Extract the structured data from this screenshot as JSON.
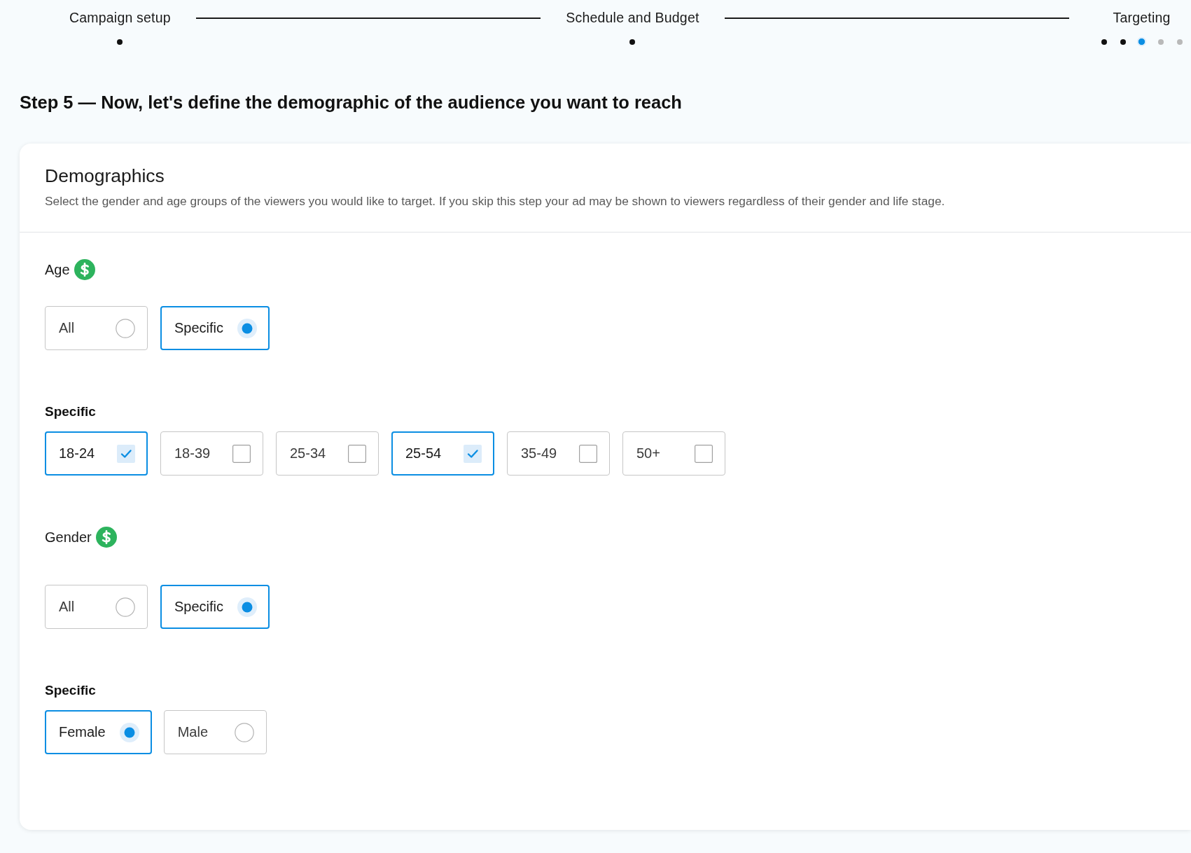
{
  "stepper": {
    "steps": [
      {
        "label": "Campaign setup",
        "dots": [
          {
            "completed": true,
            "selected": false
          }
        ]
      },
      {
        "label": "Schedule and Budget",
        "dots": [
          {
            "completed": true,
            "selected": false
          }
        ]
      },
      {
        "label": "Targeting",
        "dots": [
          {
            "completed": true,
            "selected": false
          },
          {
            "completed": true,
            "selected": false
          },
          {
            "completed": false,
            "selected": true
          },
          {
            "completed": false,
            "selected": false
          },
          {
            "completed": false,
            "selected": false
          }
        ]
      }
    ]
  },
  "heading": "Step 5 — Now, let's define the demographic of the audience you want to reach",
  "demographics": {
    "title": "Demographics",
    "description": "Select the gender and age groups of the viewers you would like to target. If you skip this step your ad may be shown to viewers regardless of their gender and life stage.",
    "groups": [
      {
        "label": "Age",
        "modes": [
          {
            "label": "All",
            "selected": false
          },
          {
            "label": "Specific",
            "selected": true
          }
        ],
        "specific": {
          "label": "Specific",
          "kind": "checkbox",
          "options": [
            {
              "label": "18-24",
              "checked": true
            },
            {
              "label": "18-39",
              "checked": false
            },
            {
              "label": "25-34",
              "checked": false
            },
            {
              "label": "25-54",
              "checked": true
            },
            {
              "label": "35-49",
              "checked": false
            },
            {
              "label": "50+",
              "checked": false
            }
          ]
        }
      },
      {
        "label": "Gender",
        "modes": [
          {
            "label": "All",
            "selected": false
          },
          {
            "label": "Specific",
            "selected": true
          }
        ],
        "specific": {
          "label": "Specific",
          "kind": "radio",
          "options": [
            {
              "label": "Female",
              "selected": true
            },
            {
              "label": "Male",
              "selected": false
            }
          ]
        }
      }
    ]
  }
}
